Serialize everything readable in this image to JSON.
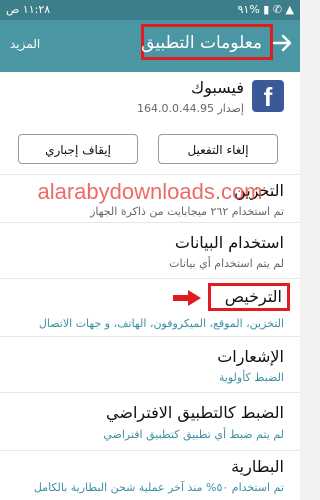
{
  "status_bar": {
    "time": "١١:٢٨ ص",
    "icons_text": "٩١% ▮ ✆ ▲"
  },
  "header": {
    "title": "معلومات التطبيق",
    "more_label": "المزيد",
    "back_icon": "arrow-forward-icon"
  },
  "app": {
    "name": "فيسبوك",
    "version": "إصدار 164.0.0.44.95",
    "icon_letter": "f"
  },
  "buttons": {
    "disable": "إلغاء التفعيل",
    "force_stop": "إيقاف إجباري"
  },
  "sections": [
    {
      "title": "التخزين",
      "subtitle": "تم استخدام ٢٦٢ ميجابايت من ذاكرة الجهاز"
    },
    {
      "title": "استخدام البيانات",
      "subtitle": "لم يتم استخدام أي بيانات"
    },
    {
      "title": "الترخيص",
      "subtitle": "التخزين، الموقع، الميكروفون، الهاتف، و جهات الاتصال"
    },
    {
      "title": "الإشعارات",
      "subtitle": "الضبط كأولوية"
    },
    {
      "title": "الضبط كالتطبيق الافتراضي",
      "subtitle": "لم يتم ضبط أي تطبيق كتطبيق افتراضي"
    },
    {
      "title": "البطارية",
      "subtitle": "تم استخدام ٥٠% منذ آخر عملية شحن البطارية بالكامل"
    }
  ],
  "watermark": "alarabydownloads.com",
  "colors": {
    "status_bar": "#3c7f8b",
    "app_bar": "#4b96a3",
    "highlight_red": "#e11b22",
    "link_teal": "#3d8fa4",
    "facebook_blue": "#3b5998"
  }
}
